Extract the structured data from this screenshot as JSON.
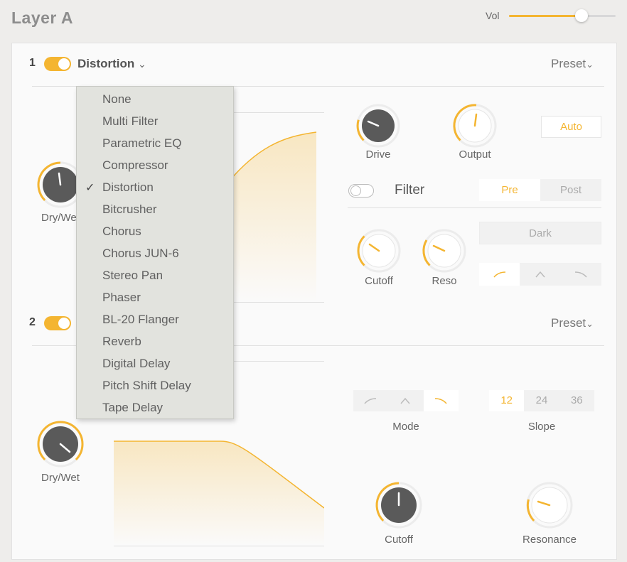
{
  "header": {
    "title": "Layer A",
    "vol_label": "Vol",
    "vol_level": 0.68
  },
  "slot1": {
    "number": "1",
    "effect": "Distortion",
    "preset_label": "Preset",
    "drywet_label": "Dry/Wet",
    "drive_label": "Drive",
    "output_label": "Output",
    "auto_label": "Auto",
    "filter_label": "Filter",
    "pre_label": "Pre",
    "post_label": "Post",
    "dark_label": "Dark",
    "cutoff_label": "Cutoff",
    "reso_label": "Reso"
  },
  "slot2": {
    "number": "2",
    "preset_label": "Preset",
    "drywet_label": "Dry/Wet",
    "mode_label": "Mode",
    "slope_label": "Slope",
    "slope_options": [
      "12",
      "24",
      "36"
    ],
    "cutoff_label": "Cutoff",
    "resonance_label": "Resonance"
  },
  "menu": {
    "selected": "Distortion",
    "check": "✓",
    "items": [
      "None",
      "Multi Filter",
      "Parametric EQ",
      "Compressor",
      "Distortion",
      "Bitcrusher",
      "Chorus",
      "Chorus JUN-6",
      "Stereo Pan",
      "Phaser",
      "BL-20 Flanger",
      "Reverb",
      "Digital Delay",
      "Pitch Shift Delay",
      "Tape Delay"
    ]
  },
  "colors": {
    "accent": "#f4b531",
    "knob": "#595959",
    "panel": "#fafafa"
  }
}
